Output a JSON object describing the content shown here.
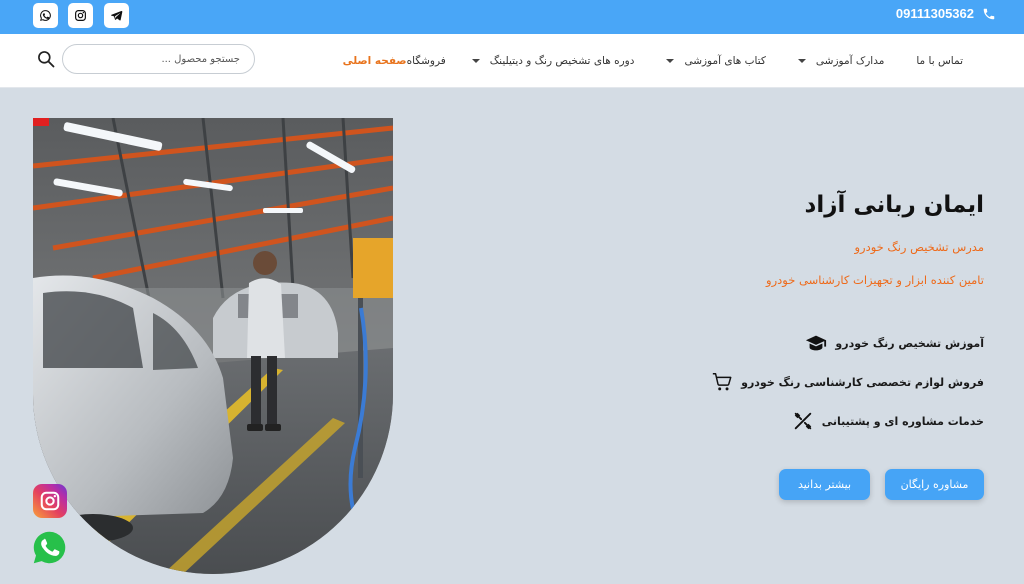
{
  "topbar": {
    "phone": "09111305362",
    "social": [
      "whatsapp-icon",
      "instagram-icon",
      "telegram-icon"
    ],
    "color": "#49a6f7"
  },
  "nav": {
    "items": [
      {
        "label": "صفحه اصلی",
        "active": true,
        "dropdown": false
      },
      {
        "label": "فروشگاه",
        "active": false,
        "dropdown": false
      },
      {
        "label": "دوره های تشخیص رنگ و دیتیلینگ",
        "active": false,
        "dropdown": true
      },
      {
        "label": "کتاب های آموزشی",
        "active": false,
        "dropdown": true
      },
      {
        "label": "مدارک آموزشی",
        "active": false,
        "dropdown": true
      },
      {
        "label": "تماس با ما",
        "active": false,
        "dropdown": false
      }
    ],
    "active_color": "#e8731c"
  },
  "search": {
    "placeholder": "جستجو محصول ..."
  },
  "hero": {
    "title": "ایمان ربانی آزاد",
    "subtitle1": "مدرس تشخیص رنگ خودرو",
    "subtitle2": "تامین کننده ابزار و تجهیزات کارشناسی خودرو",
    "accent": "#ee6a1a",
    "features": [
      {
        "icon": "graduation-cap-icon",
        "label": "آموزش تشخیص رنگ خودرو"
      },
      {
        "icon": "shopping-cart-icon",
        "label": "فروش لوازم تخصصی کارشناسی رنگ خودرو"
      },
      {
        "icon": "tools-icon",
        "label": "خدمات مشاوره ای و پشتیبانی"
      }
    ],
    "buttons": {
      "consult": "مشاوره رایگان",
      "more": "بیشتر بدانید"
    },
    "button_color": "#46a4f6"
  }
}
